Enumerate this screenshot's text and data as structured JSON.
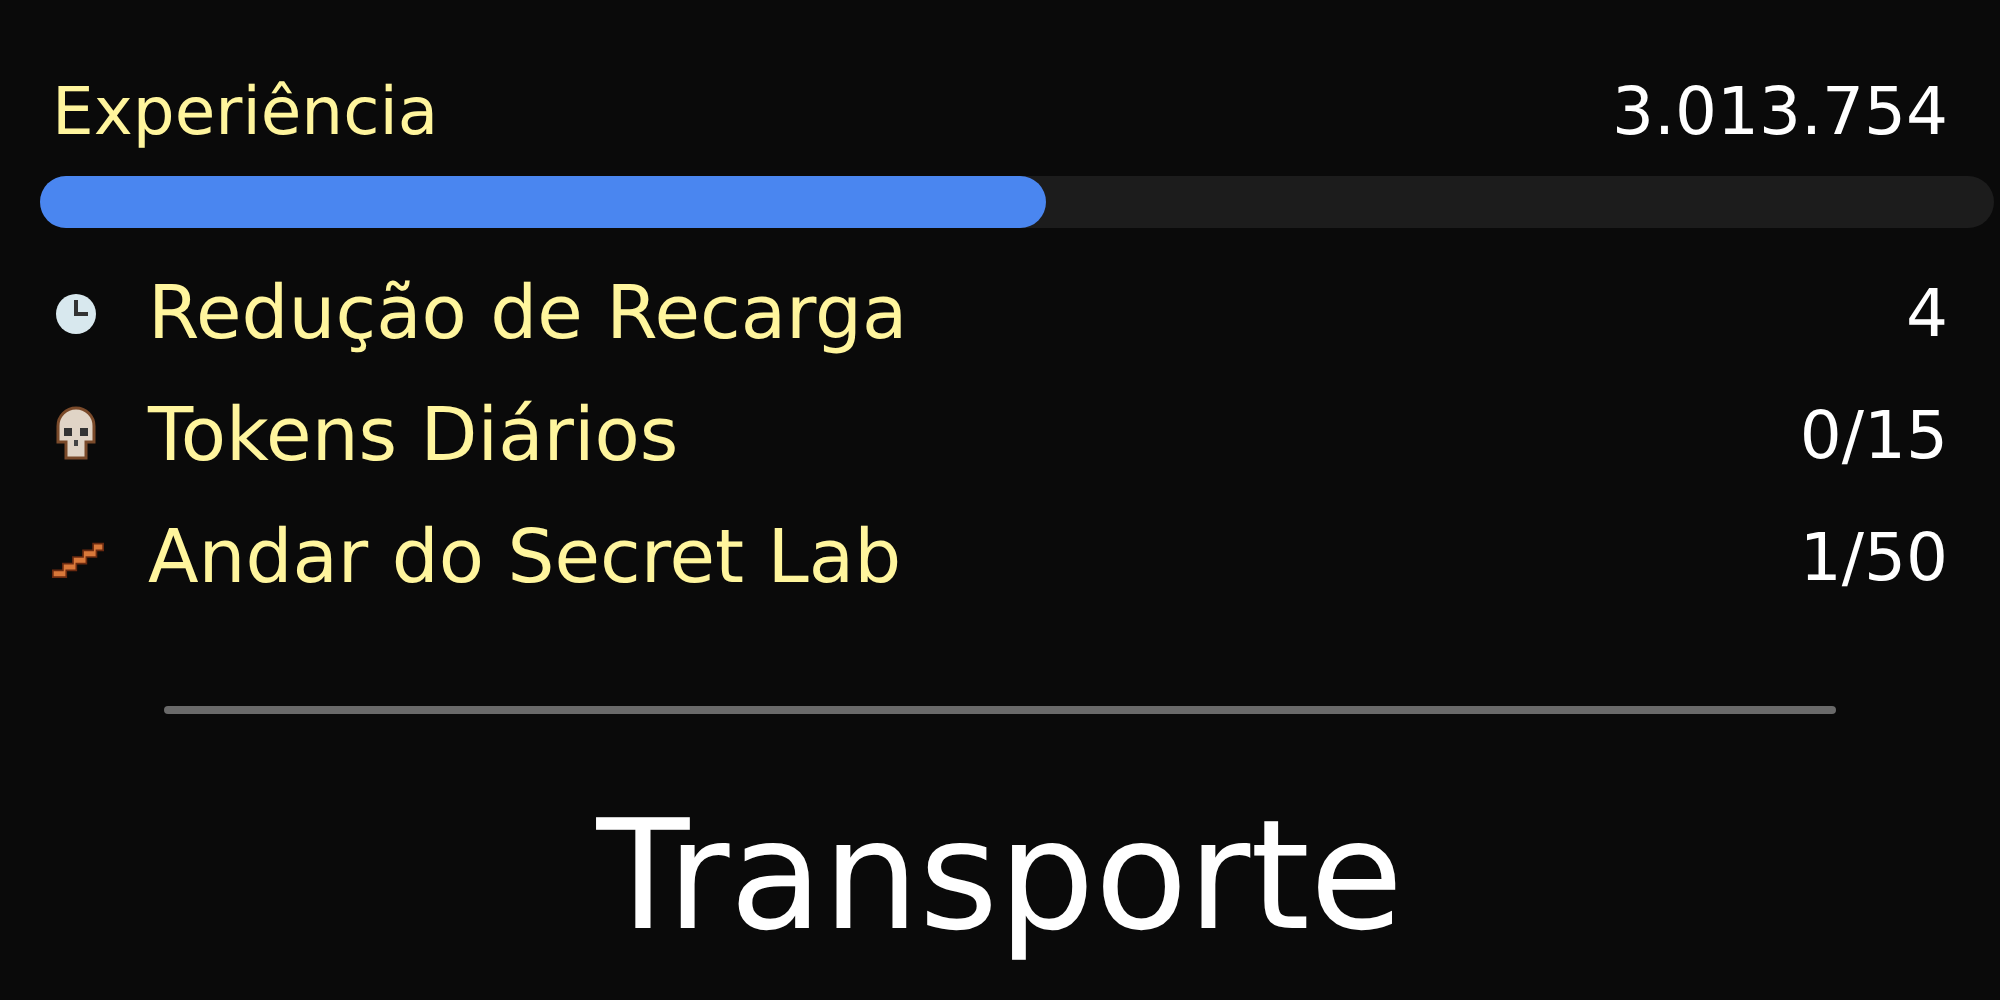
{
  "experience": {
    "label": "Experiência",
    "value": "3.013.754",
    "level": 0.515
  },
  "stats": [
    {
      "kind": "clock",
      "label": "Redução de Recarga",
      "value": "4"
    },
    {
      "kind": "skull",
      "label": "Tokens Diários",
      "value": "0/15"
    },
    {
      "kind": "stairs",
      "label": "Andar do Secret Lab",
      "value": "1/50"
    }
  ],
  "section_title": "Transporte"
}
